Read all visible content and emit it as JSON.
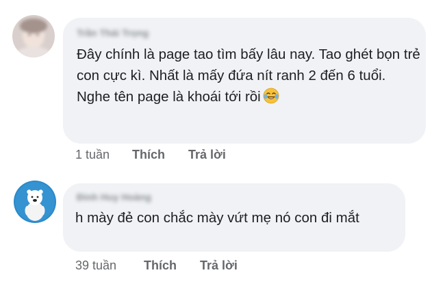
{
  "comments": [
    {
      "author": "Trần Thái Trọng",
      "text": "Đây chính là page tao tìm bấy lâu nay. Tao ghét bọn trẻ con cực kì. Nhất là mấy đứa nít ranh 2 đến 6 tuổi. Nghe tên page là khoái tới rồi",
      "emoji": "laughing-tears-emoji",
      "time": "1 tuần",
      "like_label": "Thích",
      "reply_label": "Trả lời"
    },
    {
      "author": "Đinh Huy Hoàng",
      "text": "h mày đẻ con chắc mày vứt mẹ nó con đi mắt",
      "time": "39 tuần",
      "like_label": "Thích",
      "reply_label": "Trả lời"
    }
  ],
  "colors": {
    "bubble": "#f0f2f5",
    "text": "#1c1e21",
    "meta": "#65676b",
    "avatar2_bg": "#2b89c8"
  }
}
